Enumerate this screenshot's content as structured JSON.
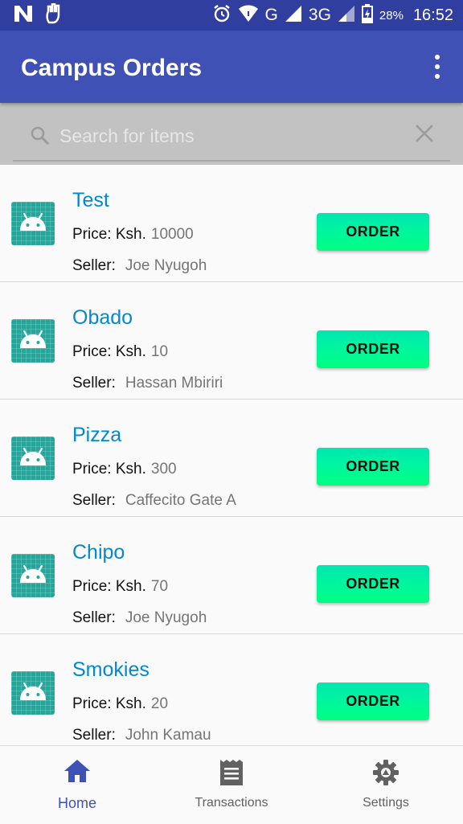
{
  "status_bar": {
    "network": "G",
    "network2": "3G",
    "battery": "28%",
    "time": "16:52"
  },
  "app_bar": {
    "title": "Campus Orders"
  },
  "search": {
    "placeholder": "Search for items"
  },
  "list": {
    "price_label": "Price: Ksh.",
    "seller_label": "Seller:",
    "order_label": "ORDER",
    "items": [
      {
        "name": "Test",
        "price": "10000",
        "seller": "Joe Nyugoh"
      },
      {
        "name": "Obado",
        "price": "10",
        "seller": "Hassan Mbiriri"
      },
      {
        "name": "Pizza",
        "price": "300",
        "seller": "Caffecito Gate A"
      },
      {
        "name": "Chipo",
        "price": "70",
        "seller": "Joe Nyugoh"
      },
      {
        "name": "Smokies",
        "price": "20",
        "seller": "John Kamau"
      }
    ]
  },
  "bottom_nav": {
    "items": [
      {
        "label": "Home",
        "icon": "home-icon",
        "active": true
      },
      {
        "label": "Transactions",
        "icon": "receipt-icon",
        "active": false
      },
      {
        "label": "Settings",
        "icon": "gear-icon",
        "active": false
      }
    ]
  },
  "colors": {
    "primary": "#3f51b5",
    "primary_dark": "#303f9f",
    "accent_link": "#0288d1",
    "button": "#00f5a0"
  }
}
